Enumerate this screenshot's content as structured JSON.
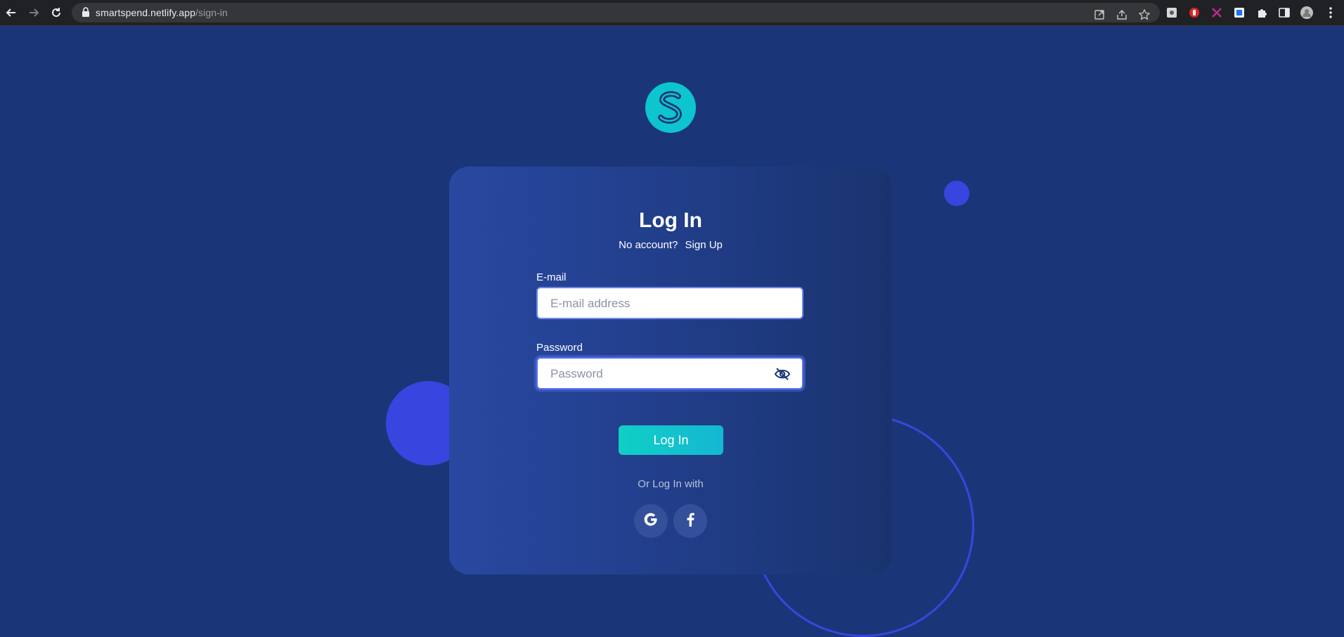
{
  "browser": {
    "url_host": "smartspend.netlify.app",
    "url_path": "/sign-in"
  },
  "page": {
    "title": "Log In",
    "no_account_text": "No account?",
    "sign_up_link": "Sign Up",
    "email": {
      "label": "E-mail",
      "placeholder": "E-mail address",
      "value": ""
    },
    "password": {
      "label": "Password",
      "placeholder": "Password",
      "value": ""
    },
    "login_button": "Log In",
    "or_login_with": "Or Log In with",
    "social": [
      "google-icon",
      "facebook-icon"
    ]
  },
  "colors": {
    "background": "#1a3678",
    "accent_teal": "#0cc5cf",
    "decor_blue": "#3846df"
  }
}
